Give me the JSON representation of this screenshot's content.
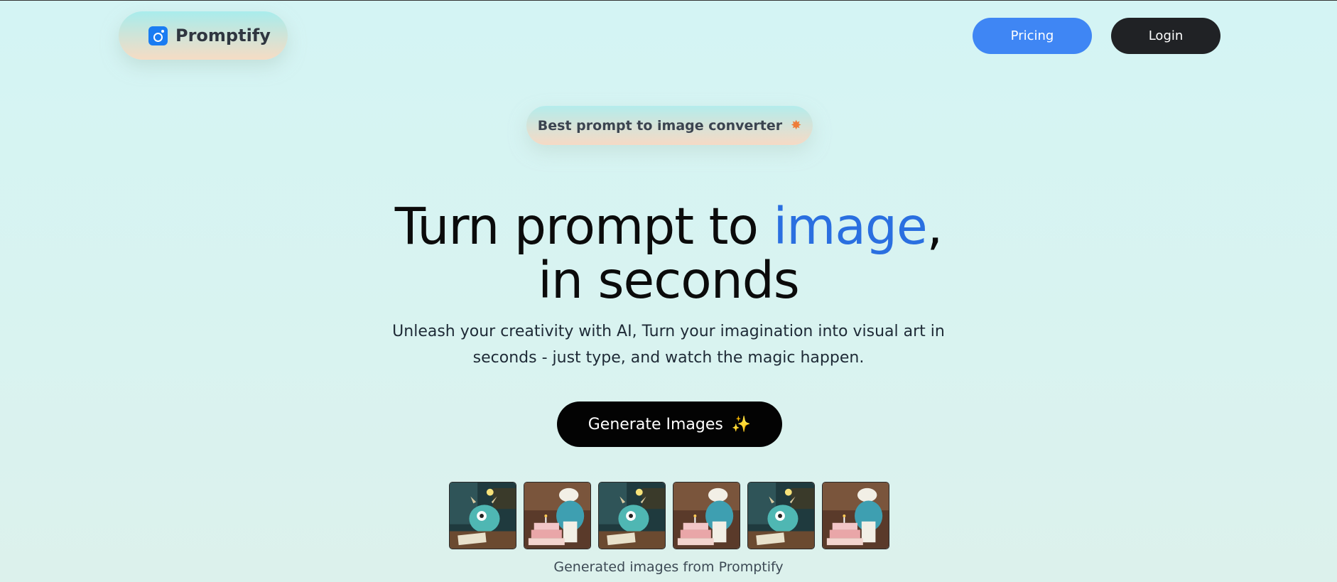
{
  "nav": {
    "brand": "Promptify",
    "pricing_label": "Pricing",
    "login_label": "Login"
  },
  "badge": {
    "text": "Best prompt to image converter",
    "icon": "star-burst-icon"
  },
  "hero": {
    "title_part1": "Turn prompt to ",
    "title_accent": "image",
    "title_part2": ",",
    "title_line2": "in seconds",
    "subtitle": "Unleash your creativity with AI, Turn your imagination into visual art in seconds - just type, and watch the magic happen.",
    "cta_label": "Generate Images",
    "cta_icon": "sparkles-icon"
  },
  "gallery": {
    "images": [
      "monster-at-desk",
      "monster-chef-with-cake",
      "monster-at-desk",
      "monster-chef-with-cake",
      "monster-at-desk",
      "monster-chef-with-cake"
    ],
    "caption": "Generated images from Promptify"
  },
  "colors": {
    "background": "#d4f4f4",
    "accent_blue": "#2a6fe0",
    "pricing_button": "#3f86f4",
    "login_button": "#202225",
    "cta_button": "#030303"
  }
}
